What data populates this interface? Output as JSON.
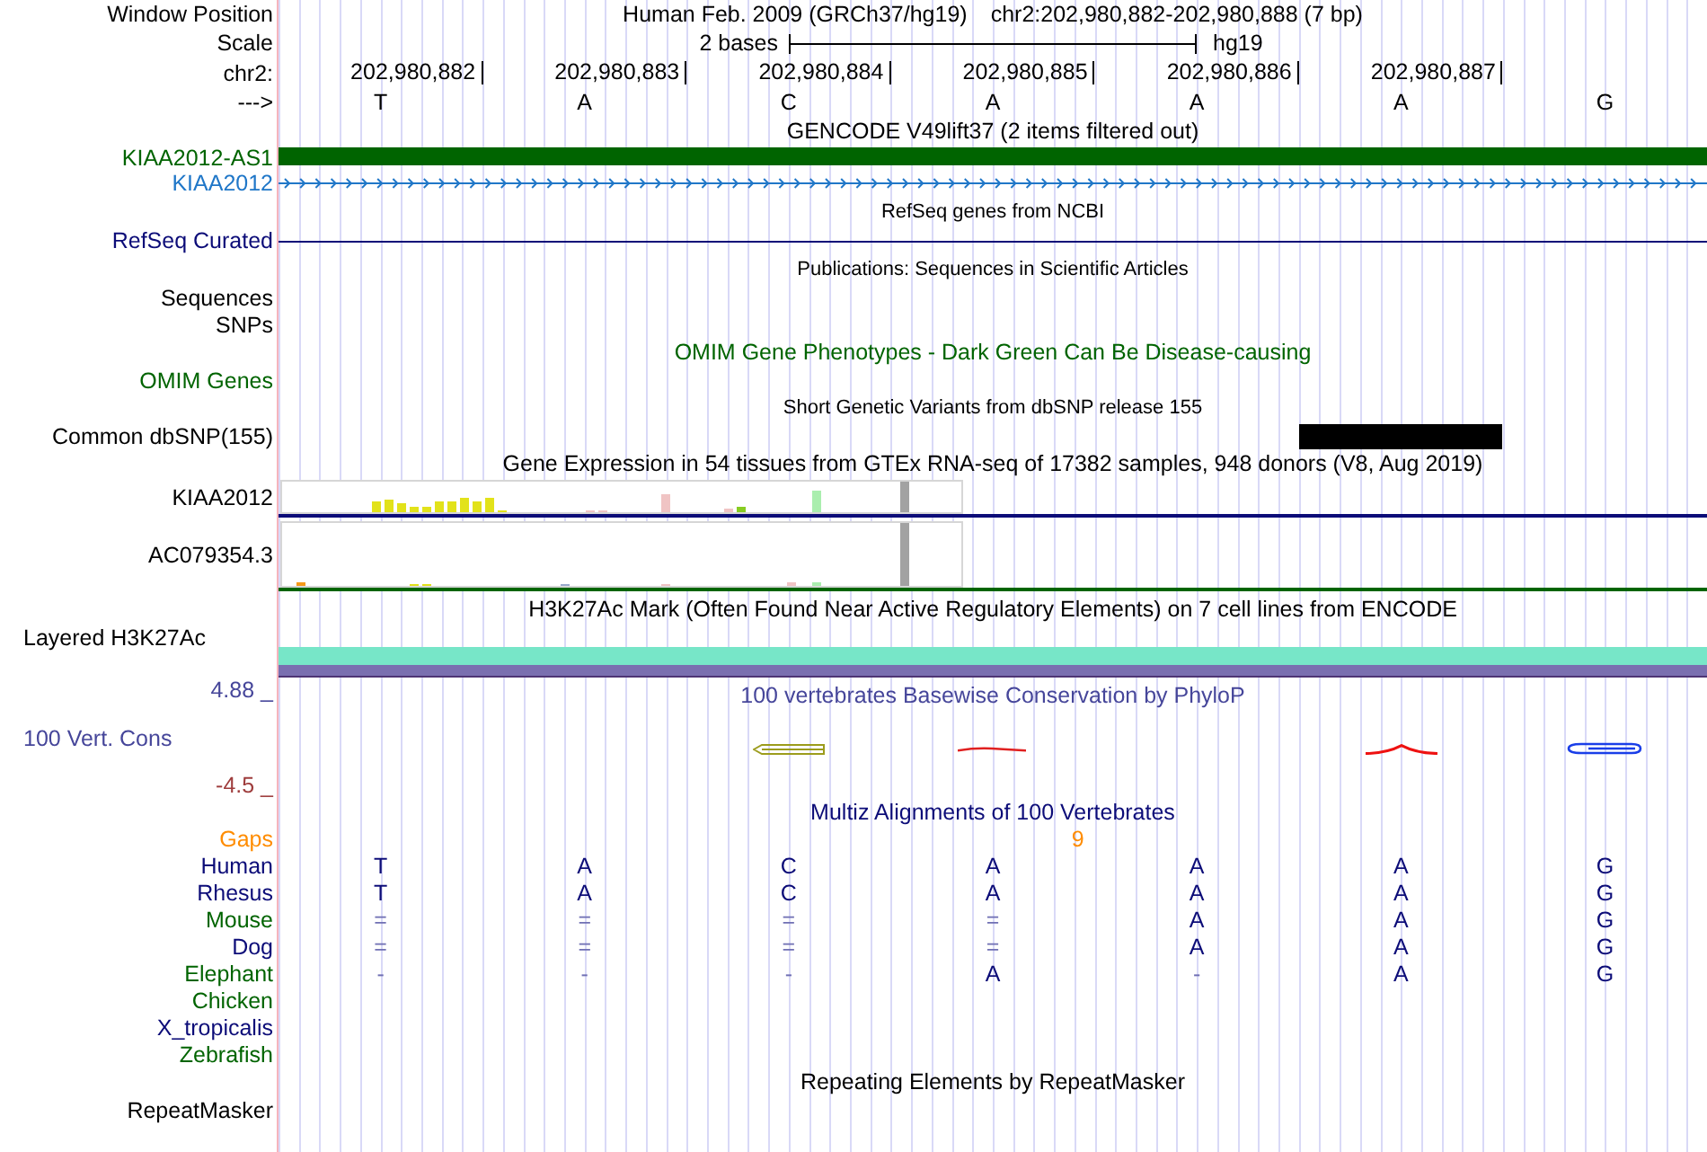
{
  "position": {
    "label": "Window Position",
    "assembly": "Human Feb. 2009 (GRCh37/hg19)",
    "range": "chr2:202,980,882-202,980,888 (7 bp)"
  },
  "scale": {
    "label": "Scale",
    "length": "2 bases",
    "assembly": "hg19"
  },
  "ruler": {
    "label": "chr2:",
    "positions": [
      "202,980,882",
      "202,980,883",
      "202,980,884",
      "202,980,885",
      "202,980,886",
      "202,980,887"
    ]
  },
  "bases": {
    "label": "--->",
    "letters": [
      "T",
      "A",
      "C",
      "A",
      "A",
      "A",
      "G"
    ]
  },
  "tracks": [
    {
      "kind": "gencode",
      "title": "GENCODE V49lift37 (2 items filtered out)",
      "color": "#000000",
      "rows": [
        {
          "label": "KIAA2012-AS1",
          "color": "#006400",
          "kind": "block"
        },
        {
          "label": "KIAA2012",
          "color": "#2077c8",
          "kind": "arrows"
        }
      ]
    },
    {
      "kind": "refseq",
      "title": "RefSeq genes from NCBI",
      "color": "#000000",
      "rows": [
        {
          "label": "RefSeq Curated",
          "color": "#0c0c78",
          "kind": "line"
        }
      ]
    },
    {
      "kind": "publications",
      "title": "Publications: Sequences in Scientific Articles",
      "color": "#000000",
      "rows": [
        {
          "label": "Sequences",
          "color": "#000000",
          "kind": "empty"
        },
        {
          "label": "SNPs",
          "color": "#000000",
          "kind": "empty"
        }
      ]
    },
    {
      "kind": "omim",
      "title": "OMIM Gene Phenotypes - Dark Green Can Be Disease-causing",
      "color": "#006400",
      "rows": [
        {
          "label": "OMIM Genes",
          "color": "#006400",
          "kind": "empty"
        }
      ]
    },
    {
      "kind": "snp",
      "title": "Short Genetic Variants from dbSNP release 155",
      "color": "#000000",
      "rows": [
        {
          "label": "Common dbSNP(155)",
          "color": "#000000",
          "kind": "variants",
          "cells": [
            {
              "kind": "none"
            },
            {
              "kind": "none"
            },
            {
              "kind": "none"
            },
            {
              "kind": "none"
            },
            {
              "kind": "none"
            },
            {
              "kind": "variant"
            },
            {
              "kind": "none"
            }
          ]
        }
      ]
    },
    {
      "kind": "gtex",
      "title": "Gene Expression in 54 tissues from GTEx RNA-seq of 17382 samples, 948 donors (V8, Aug 2019)",
      "color": "#000000",
      "rows": [
        {
          "label": "KIAA2012",
          "color": "#0c0c78",
          "kind": "expression"
        },
        {
          "label": "AC079354.3",
          "color": "#006400",
          "kind": "expression"
        }
      ]
    },
    {
      "kind": "signal",
      "title": "H3K27Ac Mark (Often Found Near Active Regulatory Elements) on 7 cell lines from ENCODE",
      "color": "#000000",
      "rows": [
        {
          "label": "Layered H3K27Ac",
          "color": "#000000",
          "kind": "layered"
        }
      ]
    },
    {
      "kind": "conservation",
      "title": "100 vertebrates Basewise Conservation by PhyloP",
      "color": "#46469a",
      "axis": [
        {
          "text": "4.88 _",
          "color": "#46469a"
        },
        {
          "text": "-4.5 _",
          "color": "#9e3c3c"
        }
      ],
      "rows": [
        {
          "label": "100 Vert. Cons",
          "color": "#46469a",
          "kind": "phylop"
        }
      ]
    },
    {
      "kind": "multiz",
      "title": "Multiz Alignments of 100 Vertebrates",
      "color": "#0c0c78",
      "rows": [
        {
          "label": "Gaps",
          "color": "#ff8c00",
          "kind": "gaps",
          "cells": [
            {
              "kind": "none"
            },
            {
              "kind": "none"
            },
            {
              "kind": "none"
            },
            {
              "kind": "insert",
              "text": "9"
            },
            {
              "kind": "none"
            },
            {
              "kind": "none"
            },
            {
              "kind": "none"
            }
          ]
        },
        {
          "label": "Human",
          "color": "#0c0c78",
          "kind": "species",
          "cells": [
            {
              "text": "T",
              "kind": "base"
            },
            {
              "text": "A",
              "kind": "base"
            },
            {
              "text": "C",
              "kind": "base"
            },
            {
              "text": "A",
              "kind": "base"
            },
            {
              "text": "A",
              "kind": "base"
            },
            {
              "text": "A",
              "kind": "base"
            },
            {
              "text": "G",
              "kind": "base"
            }
          ]
        },
        {
          "label": "Rhesus",
          "color": "#0c0c78",
          "kind": "species",
          "cells": [
            {
              "text": "T",
              "kind": "base"
            },
            {
              "text": "A",
              "kind": "base"
            },
            {
              "text": "C",
              "kind": "base"
            },
            {
              "text": "A",
              "kind": "base"
            },
            {
              "text": "A",
              "kind": "base"
            },
            {
              "text": "A",
              "kind": "base"
            },
            {
              "text": "G",
              "kind": "base"
            }
          ]
        },
        {
          "label": "Mouse",
          "color": "#006400",
          "kind": "species",
          "cells": [
            {
              "text": "=",
              "kind": "match"
            },
            {
              "text": "=",
              "kind": "match"
            },
            {
              "text": "=",
              "kind": "match"
            },
            {
              "text": "=",
              "kind": "match"
            },
            {
              "text": "A",
              "kind": "base"
            },
            {
              "text": "A",
              "kind": "base"
            },
            {
              "text": "G",
              "kind": "base"
            }
          ]
        },
        {
          "label": "Dog",
          "color": "#0c0c78",
          "kind": "species",
          "cells": [
            {
              "text": "=",
              "kind": "match"
            },
            {
              "text": "=",
              "kind": "match"
            },
            {
              "text": "=",
              "kind": "match"
            },
            {
              "text": "=",
              "kind": "match"
            },
            {
              "text": "A",
              "kind": "base"
            },
            {
              "text": "A",
              "kind": "base"
            },
            {
              "text": "G",
              "kind": "base"
            }
          ]
        },
        {
          "label": "Elephant",
          "color": "#006400",
          "kind": "species",
          "cells": [
            {
              "text": "-",
              "kind": "gap"
            },
            {
              "text": "-",
              "kind": "gap"
            },
            {
              "text": "-",
              "kind": "gap"
            },
            {
              "text": "A",
              "kind": "base"
            },
            {
              "text": "-",
              "kind": "gap"
            },
            {
              "text": "A",
              "kind": "base"
            },
            {
              "text": "G",
              "kind": "base"
            }
          ]
        },
        {
          "label": "Chicken",
          "color": "#006400",
          "kind": "species"
        },
        {
          "label": "X_tropicalis",
          "color": "#0c0c78",
          "kind": "species"
        },
        {
          "label": "Zebrafish",
          "color": "#006400",
          "kind": "species"
        }
      ]
    },
    {
      "kind": "repeatmasker",
      "title": "Repeating Elements by RepeatMasker",
      "color": "#000000",
      "rows": [
        {
          "label": "RepeatMasker",
          "color": "#000000",
          "kind": "empty"
        }
      ]
    }
  ]
}
